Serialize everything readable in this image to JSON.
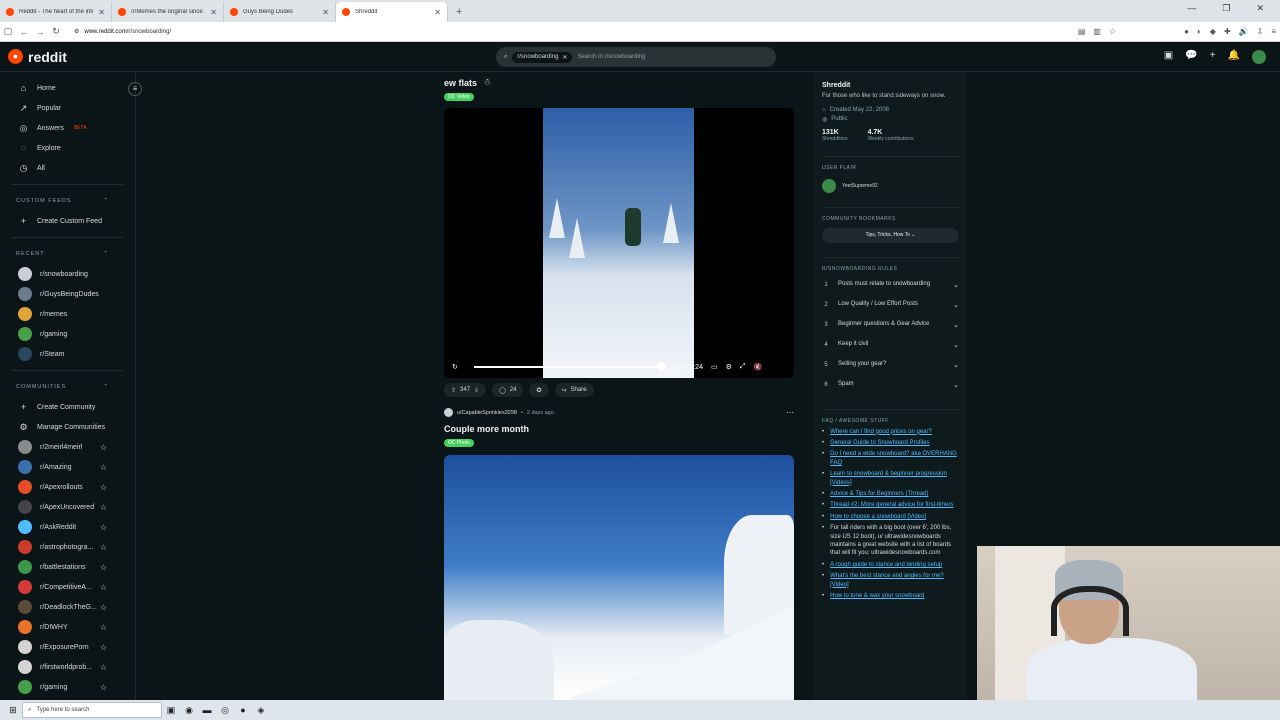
{
  "browser": {
    "tabs": [
      {
        "title": "Reddit - The heart of the intern",
        "active": false
      },
      {
        "title": "/r/Memes the original since 20",
        "active": false
      },
      {
        "title": "Guys Being Dudes",
        "active": false
      },
      {
        "title": "Shreddit",
        "active": true
      }
    ],
    "url_host": "www.reddit.com",
    "url_path": "/r/snowboarding/"
  },
  "header": {
    "logo_text": "reddit",
    "search_chip": "r/snowboarding",
    "search_placeholder": "Search in r/snowboarding"
  },
  "sidebar": {
    "nav": [
      {
        "label": "Home",
        "icon": "home-icon"
      },
      {
        "label": "Popular",
        "icon": "popular-icon"
      },
      {
        "label": "Answers",
        "icon": "answers-icon",
        "badge": "BETA"
      },
      {
        "label": "Explore",
        "icon": "explore-icon"
      },
      {
        "label": "All",
        "icon": "all-icon"
      }
    ],
    "custom_feeds_header": "CUSTOM FEEDS",
    "create_custom_feed": "Create Custom Feed",
    "recent_header": "RECENT",
    "recent": [
      {
        "label": "r/snowboarding",
        "color": "#c9d1d6"
      },
      {
        "label": "r/GuysBeingDudes",
        "color": "#6b7b8a"
      },
      {
        "label": "r/memes",
        "color": "#e2a33b"
      },
      {
        "label": "r/gaming",
        "color": "#46a04a"
      },
      {
        "label": "r/Steam",
        "color": "#2a475e"
      }
    ],
    "communities_header": "COMMUNITIES",
    "create_community": "Create Community",
    "manage_communities": "Manage Communities",
    "communities": [
      {
        "label": "r/2meirl4meirl",
        "color": "#8a8a8a"
      },
      {
        "label": "r/Amazing",
        "color": "#3b6fb0"
      },
      {
        "label": "r/Apexrollouts",
        "color": "#e44d26"
      },
      {
        "label": "r/ApexUncovered",
        "color": "#444444"
      },
      {
        "label": "r/AskReddit",
        "color": "#4fbcff"
      },
      {
        "label": "r/astrophotogra...",
        "color": "#cc3b2b"
      },
      {
        "label": "r/battlestations",
        "color": "#3a9a4a"
      },
      {
        "label": "r/CompetitiveA...",
        "color": "#d43a3a"
      },
      {
        "label": "r/DeadlockTheG...",
        "color": "#5a4a3a"
      },
      {
        "label": "r/DIWHY",
        "color": "#e8732a"
      },
      {
        "label": "r/ExposurePorn",
        "color": "#d4d4d4"
      },
      {
        "label": "r/firstworldprob...",
        "color": "#d4d4d4"
      },
      {
        "label": "r/gaming",
        "color": "#46a04a"
      }
    ]
  },
  "post1": {
    "title": "ew flats",
    "flair": "OC Video",
    "time": "0:24 / 0:24",
    "progress": 1.0,
    "upvotes": "347",
    "comments": "24",
    "share": "Share"
  },
  "post2": {
    "author": "u/CapableSprinkles3298",
    "age": "2 days ago",
    "title": "Couple more month",
    "flair": "OC Photo"
  },
  "community": {
    "name": "Shreddit",
    "description": "For those who like to stand sideways on snow.",
    "created": "Created May 22, 2008",
    "visibility": "Public",
    "members": "131K",
    "members_label": "Shredditors",
    "contributions": "4.7K",
    "contributions_label": "Weekly contributions",
    "user_flair_header": "USER FLAIR",
    "user_flair_name": "YeetSupreme92",
    "bookmarks_header": "COMMUNITY BOOKMARKS",
    "bookmark_button": "Tips, Tricks, How To",
    "rules_header": "R/SNOWBOARDING RULES",
    "rules": [
      {
        "num": "1",
        "text": "Posts must relate to snowboarding"
      },
      {
        "num": "2",
        "text": "Low Quality / Low Effort Posts"
      },
      {
        "num": "3",
        "text": "Beginner questions & Gear Advice"
      },
      {
        "num": "4",
        "text": "Keep it civil"
      },
      {
        "num": "5",
        "text": "Selling your gear?"
      },
      {
        "num": "6",
        "text": "Spam"
      }
    ],
    "faq_header": "FAQ / AWESOME STUFF",
    "faq": [
      {
        "text": "Where can I find good prices on gear?",
        "link": true
      },
      {
        "text": "General Guide to Snowboard Profiles",
        "link": true
      },
      {
        "text": "Do I need a wide snowboard? aka OVERHANG FAQ",
        "link": true
      },
      {
        "text": "Learn to snowboard & beginner progression [Videos]",
        "link": true
      },
      {
        "text": "Advice & Tips for Beginners (Thread)",
        "link": true
      },
      {
        "text": "Thread #2: More general advice for first-timers",
        "link": true
      },
      {
        "text": "How to choose a snowboard [Video]",
        "link": true
      },
      {
        "text": "For tall riders with a big boot (over 6', 200 lbs, size US 12 boot), u/ ultrawidesnowboards maintains a great website with a list of boards that will fit you: ultrawidesnowboards.com",
        "link": false
      },
      {
        "text": "A rough guide to stance and binding setup",
        "link": true
      },
      {
        "text": "What's the best stance and angles for me? [Video]",
        "link": true
      },
      {
        "text": "How to tune & wax your snowboard",
        "link": true
      }
    ]
  },
  "taskbar": {
    "search_placeholder": "Type here to search"
  }
}
